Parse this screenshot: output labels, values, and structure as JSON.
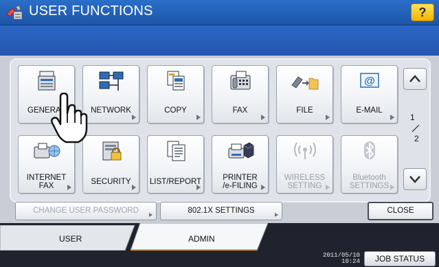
{
  "header": {
    "title": "USER FUNCTIONS",
    "help_label": "?",
    "title_icon": "toolbox-icon"
  },
  "tiles": [
    {
      "label": "GENERAL",
      "icon": "printer-copier-icon",
      "enabled": true
    },
    {
      "label": "NETWORK",
      "icon": "network-computers-icon",
      "enabled": true
    },
    {
      "label": "COPY",
      "icon": "copy-documents-icon",
      "enabled": true
    },
    {
      "label": "FAX",
      "icon": "fax-machine-icon",
      "enabled": true
    },
    {
      "label": "FILE",
      "icon": "scan-to-folder-icon",
      "enabled": true
    },
    {
      "label": "E-MAIL",
      "icon": "email-at-icon",
      "enabled": true
    },
    {
      "label": "INTERNET\nFAX",
      "line1": "INTERNET",
      "line2": "FAX",
      "icon": "internet-fax-icon",
      "enabled": true
    },
    {
      "label": "SECURITY",
      "icon": "security-lock-icon",
      "enabled": true
    },
    {
      "label": "LIST/REPORT",
      "icon": "list-report-icon",
      "enabled": true
    },
    {
      "label": "PRINTER\n/e-FILING",
      "line1": "PRINTER",
      "line2": "/e-FILING",
      "icon": "printer-box-icon",
      "enabled": true
    },
    {
      "label": "WIRELESS\nSETTING",
      "line1": "WIRELESS",
      "line2": "SETTING",
      "icon": "wireless-icon",
      "enabled": false
    },
    {
      "label": "Bluetooth\nSETTINGS",
      "line1": "Bluetooth",
      "line2": "SETTINGS",
      "icon": "bluetooth-icon",
      "enabled": false
    }
  ],
  "pager": {
    "current": "1",
    "separator": "/",
    "total": "2",
    "up_icon": "chevron-up-icon",
    "down_icon": "chevron-down-icon"
  },
  "buttons": {
    "change_password": "CHANGE USER PASSWORD",
    "settings_8021x": "802.1X SETTINGS",
    "close": "CLOSE"
  },
  "tabs": {
    "user": "USER",
    "admin": "ADMIN",
    "active": "ADMIN"
  },
  "status": {
    "date": "2011/05/10",
    "time": "10:24",
    "job_status": "JOB STATUS"
  },
  "colors": {
    "title_bar": "#1d55a8",
    "help_button": "#f0b400",
    "active_tab_accent": "#f0a020",
    "panel": "#c9ced6"
  }
}
